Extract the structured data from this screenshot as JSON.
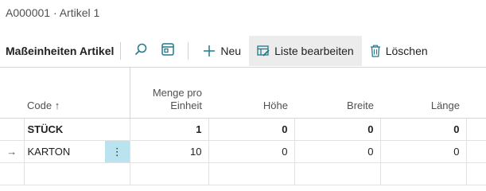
{
  "page": {
    "title": "A000001 · Artikel 1"
  },
  "toolbar": {
    "section_title": "Maßeinheiten Artikel",
    "new_label": "Neu",
    "edit_list_label": "Liste bearbeiten",
    "delete_label": "Löschen"
  },
  "table": {
    "headers": {
      "code": "Code ↑",
      "qty_line1": "Menge pro",
      "qty_line2": "Einheit",
      "height": "Höhe",
      "width": "Breite",
      "length": "Länge"
    },
    "rows": [
      {
        "indicator": "",
        "code": "STÜCK",
        "qty": "1",
        "height": "0",
        "width": "0",
        "length": "0"
      },
      {
        "indicator": "→",
        "code": "KARTON",
        "menu": "⋮",
        "qty": "10",
        "height": "0",
        "width": "0",
        "length": "0"
      }
    ]
  },
  "colors": {
    "accent": "#1f7a8c",
    "selected_cell": "#b9e4ef"
  }
}
